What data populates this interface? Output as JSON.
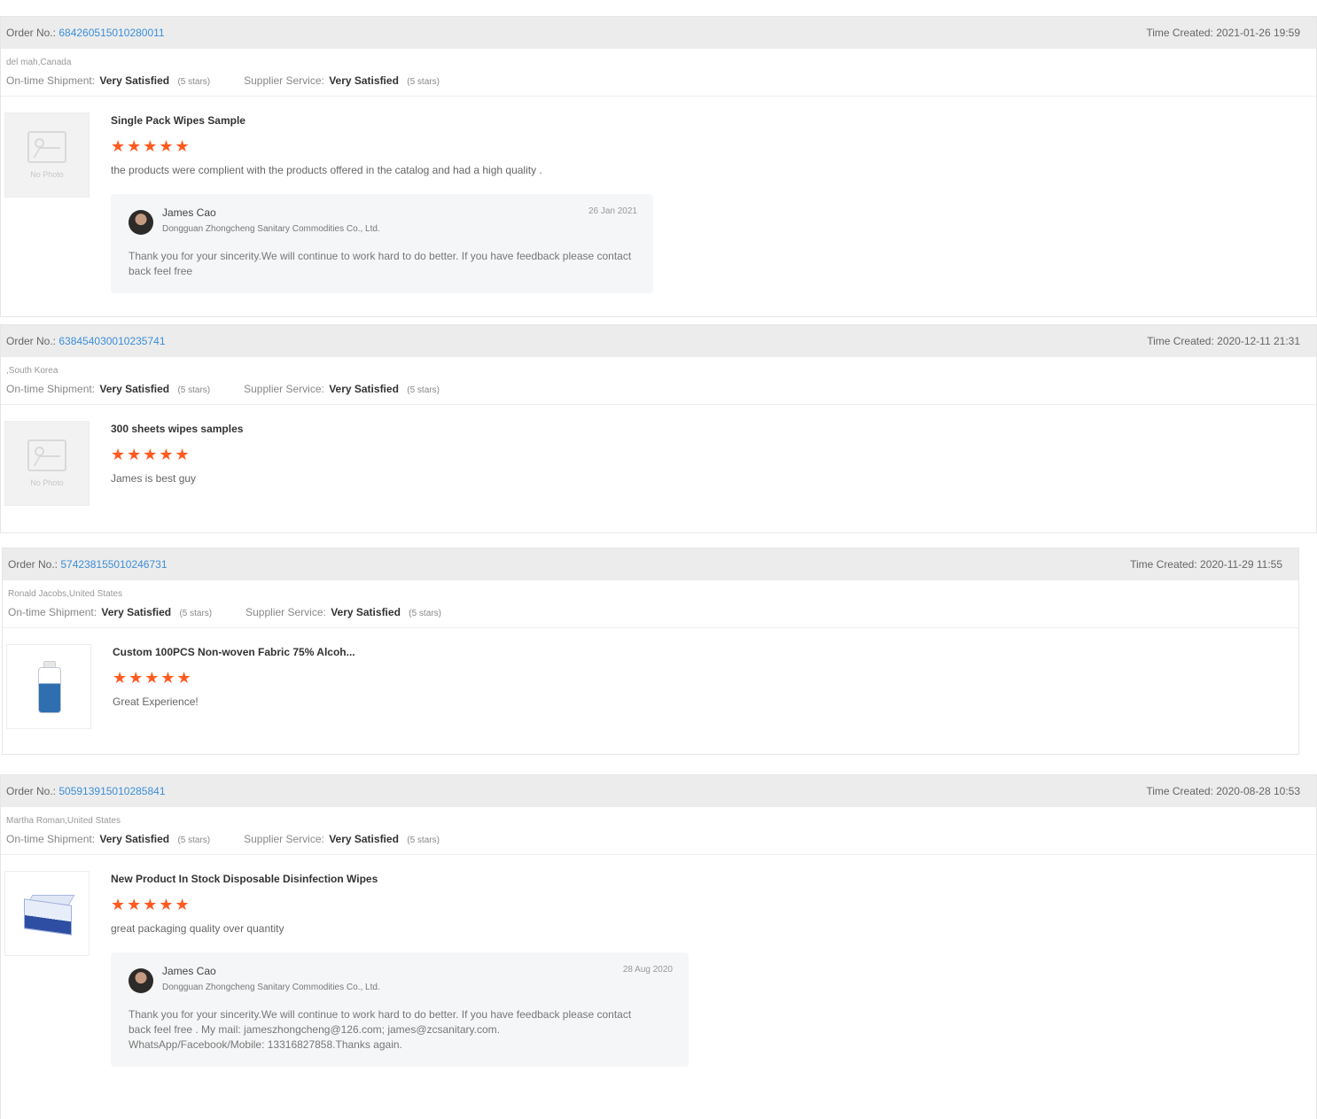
{
  "labels": {
    "order_no": "Order No.:",
    "time_created": "Time Created:",
    "on_time_shipment": "On-time Shipment:",
    "supplier_service": "Supplier Service:",
    "no_photo": "No Photo"
  },
  "colors": {
    "star": "#ff5a1f",
    "link": "#3b8ed8",
    "header_bg": "#ececec"
  },
  "reviews": [
    {
      "order_no": "684260515010280011",
      "time_created": "2021-01-26 19:59",
      "buyer": "del mah,Canada",
      "shipment_rating": "Very Satisfied",
      "shipment_stars_text": "(5 stars)",
      "service_rating": "Very Satisfied",
      "service_stars_text": "(5 stars)",
      "product_title": "Single Pack Wipes Sample",
      "stars": "★★★★★",
      "comment": "the products were complient with the products offered in the catalog and had a high quality .",
      "image": "no-photo",
      "reply": {
        "name": "James Cao",
        "company": "Dongguan Zhongcheng Sanitary Commodities Co., Ltd.",
        "date": "26 Jan 2021",
        "text_lines": [
          "Thank you for your sincerity.We will continue to work hard to do better. If you have feedback please contact",
          "back feel free"
        ]
      }
    },
    {
      "order_no": "638454030010235741",
      "time_created": "2020-12-11 21:31",
      "buyer": ",South Korea",
      "shipment_rating": "Very Satisfied",
      "shipment_stars_text": "(5 stars)",
      "service_rating": "Very Satisfied",
      "service_stars_text": "(5 stars)",
      "product_title": "300 sheets wipes samples",
      "stars": "★★★★★",
      "comment": "James is best guy",
      "image": "no-photo"
    },
    {
      "order_no": "574238155010246731",
      "time_created": "2020-11-29 11:55",
      "buyer": "Ronald Jacobs,United States",
      "shipment_rating": "Very Satisfied",
      "shipment_stars_text": "(5 stars)",
      "service_rating": "Very Satisfied",
      "service_stars_text": "(5 stars)",
      "product_title": "Custom 100PCS Non-woven Fabric 75% Alcoh...",
      "stars": "★★★★★",
      "comment": "Great Experience!",
      "image": "bottle"
    },
    {
      "order_no": "505913915010285841",
      "time_created": "2020-08-28 10:53",
      "buyer": "Martha Roman,United States",
      "shipment_rating": "Very Satisfied",
      "shipment_stars_text": "(5 stars)",
      "service_rating": "Very Satisfied",
      "service_stars_text": "(5 stars)",
      "product_title": "New Product In Stock Disposable Disinfection Wipes",
      "stars": "★★★★★",
      "comment": "great packaging quality over quantity",
      "image": "box",
      "reply": {
        "name": "James Cao",
        "company": "Dongguan Zhongcheng Sanitary Commodities Co., Ltd.",
        "date": "28 Aug 2020",
        "text_lines": [
          "Thank you for your sincerity.We will continue to work hard to do better. If you have feedback please contact",
          "back feel free . My mail: jameszhongcheng@126.com; james@zcsanitary.com.",
          "WhatsApp/Facebook/Mobile: 13316827858.Thanks again."
        ]
      }
    }
  ]
}
